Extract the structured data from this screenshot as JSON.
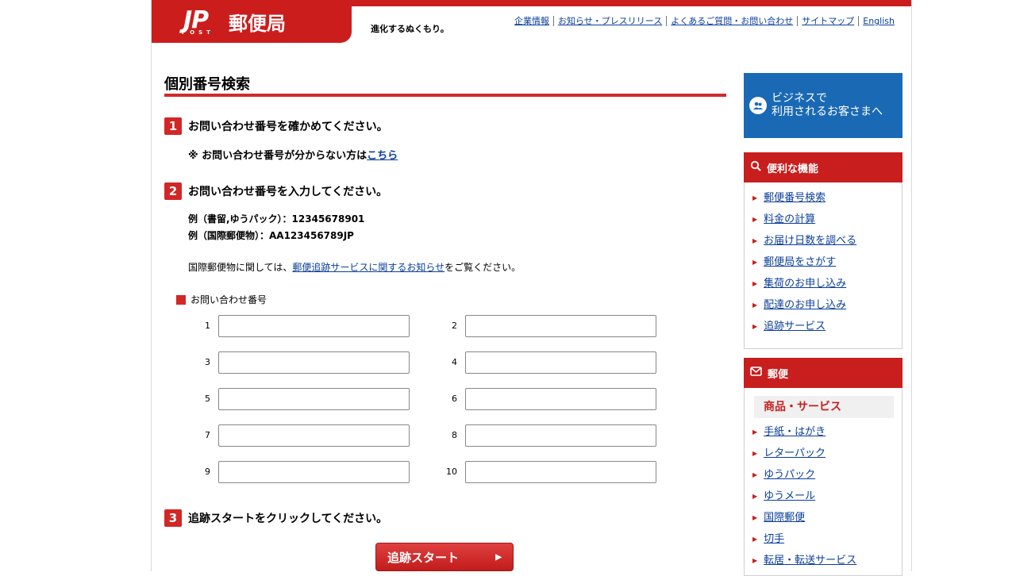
{
  "header": {
    "logo_jp": "JP",
    "logo_post": "POST",
    "logo_name": "郵便局",
    "tagline": "進化するぬくもり。",
    "util_links": [
      "企業情報",
      "お知らせ・プレスリリース",
      "よくあるご質問・お問い合わせ",
      "サイトマップ",
      "English"
    ]
  },
  "main": {
    "title": "個別番号検索",
    "step1": {
      "num": "1",
      "text": "お問い合わせ番号を確かめてください。"
    },
    "note": {
      "prefix": "※ お問い合わせ番号が分からない方は",
      "link": "こちら"
    },
    "step2": {
      "num": "2",
      "text": "お問い合わせ番号を入力してください。"
    },
    "examples": [
      "例（書留,ゆうパック）：12345678901",
      "例（国際郵便物）：AA123456789JP"
    ],
    "intl": {
      "prefix": "国際郵便物に関しては、",
      "link": "郵便追跡サービスに関するお知らせ",
      "suffix": "をご覧ください。"
    },
    "field_label": "お問い合わせ番号",
    "field_numbers": [
      "1",
      "2",
      "3",
      "4",
      "5",
      "6",
      "7",
      "8",
      "9",
      "10"
    ],
    "field_values": [
      "",
      "",
      "",
      "",
      "",
      "",
      "",
      "",
      "",
      ""
    ],
    "step3": {
      "num": "3",
      "text": "追跡スタートをクリックしてください。"
    },
    "start_button": "追跡スタート",
    "start_arrow": "▶"
  },
  "sidebar": {
    "business": {
      "icon": "user-group-icon",
      "line1": "ビジネスで",
      "line2": "利用されるお客さまへ"
    },
    "tools": {
      "icon": "search-icon",
      "title": "便利な機能",
      "items": [
        "郵便番号検索",
        "料金の計算",
        "お届け日数を調べる",
        "郵便局をさがす",
        "集荷のお申し込み",
        "配達のお申し込み",
        "追跡サービス"
      ]
    },
    "mail": {
      "icon": "envelope-icon",
      "title": "郵便",
      "subtitle": "商品・サービス",
      "items": [
        "手紙・はがき",
        "レターパック",
        "ゆうパック",
        "ゆうメール",
        "国際郵便",
        "切手",
        "転居・転送サービス"
      ]
    }
  },
  "colors": {
    "brand_red": "#cc1d1d",
    "business_blue": "#1a69b5",
    "link": "#0b3e9a"
  }
}
